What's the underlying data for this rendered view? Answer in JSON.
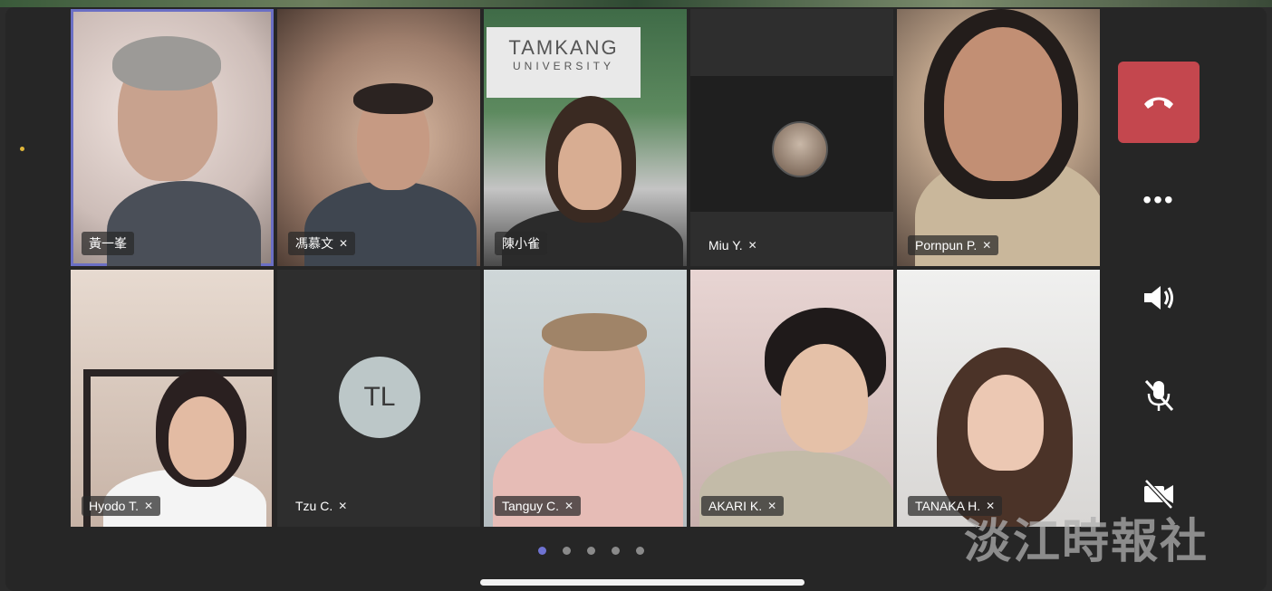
{
  "participants": [
    {
      "name": "黃一峯",
      "muted": false,
      "active": true
    },
    {
      "name": "馮慕文",
      "muted": true
    },
    {
      "name": "陳小雀",
      "muted": false,
      "sign": {
        "line1": "TAMKANG",
        "line2": "UNIVERSITY"
      }
    },
    {
      "name": "Miu Y.",
      "muted": true
    },
    {
      "name": "Pornpun P.",
      "muted": true
    },
    {
      "name": "Hyodo T.",
      "muted": true
    },
    {
      "name": "Tzu C.",
      "muted": true,
      "initials": "TL"
    },
    {
      "name": "Tanguy C.",
      "muted": true
    },
    {
      "name": "AKARI K.",
      "muted": true
    },
    {
      "name": "TANAKA H.",
      "muted": true
    }
  ],
  "controls": {
    "hangup_icon": "phone-hangup-icon",
    "more_icon": "more-dots-icon",
    "speaker_icon": "speaker-icon",
    "mic_icon": "mic-off-icon",
    "camera_icon": "camera-off-icon"
  },
  "pager": {
    "pages": 5,
    "current": 1
  },
  "watermark": "淡江時報社",
  "colors": {
    "accent": "#6b6fc4",
    "hangup": "#c4474e",
    "background": "#262626"
  }
}
